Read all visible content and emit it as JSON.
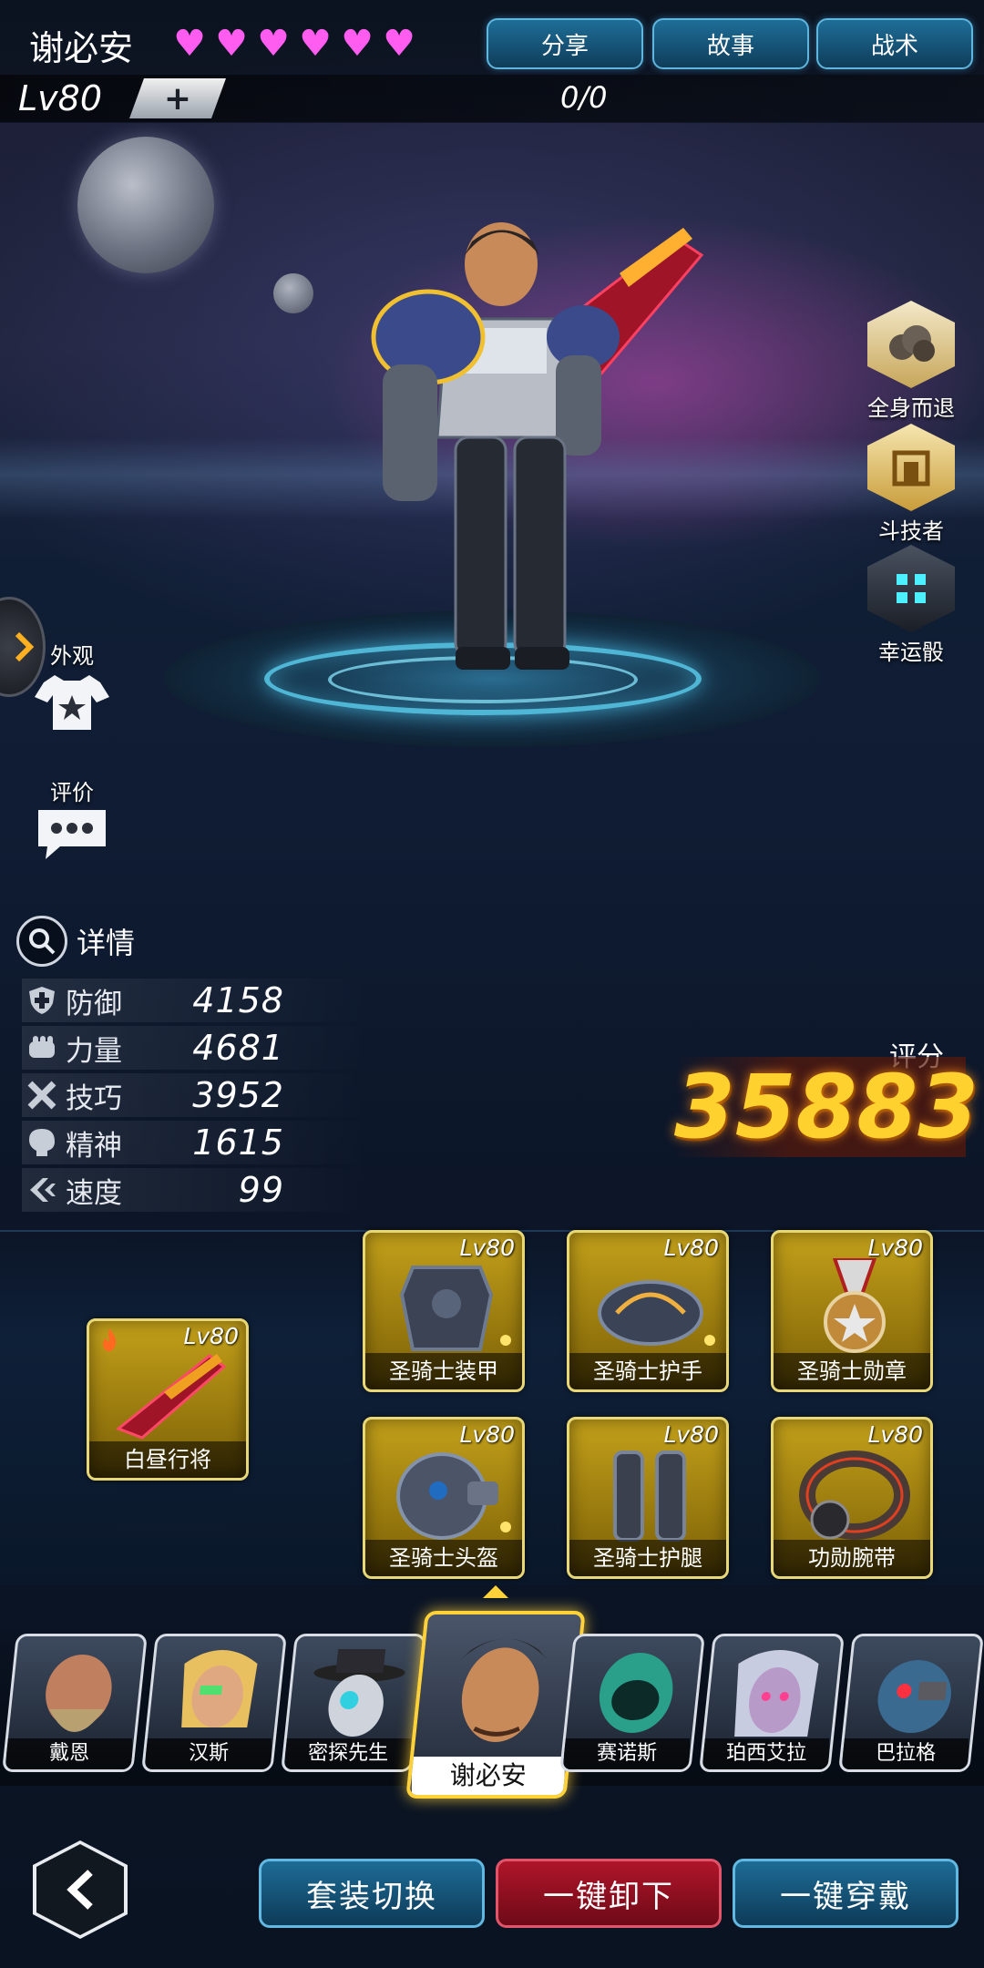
{
  "header": {
    "character_name": "谢必安",
    "hearts": [
      "♥",
      "♥",
      "♥",
      "♥",
      "♥",
      "♥"
    ],
    "heart_color": "#ff5cf0",
    "buttons": {
      "share": "分享",
      "story": "故事",
      "tactics": "战术"
    },
    "level": "Lv80",
    "level_plus": "+",
    "exp": "0/0"
  },
  "skills": [
    {
      "label": "全身而退",
      "icon": "explosion-icon"
    },
    {
      "label": "斗技者",
      "icon": "armor-emblem-icon"
    },
    {
      "label": "幸运骰",
      "icon": "dice-icon"
    }
  ],
  "side": {
    "appearance": "外观",
    "review": "评价"
  },
  "details": {
    "title": "详情",
    "stats": [
      {
        "name": "防御",
        "value": "4158",
        "icon": "shield-icon"
      },
      {
        "name": "力量",
        "value": "4681",
        "icon": "fist-icon"
      },
      {
        "name": "技巧",
        "value": "3952",
        "icon": "tools-icon"
      },
      {
        "name": "精神",
        "value": "1615",
        "icon": "brain-icon"
      },
      {
        "name": "速度",
        "value": "99",
        "icon": "speed-icon"
      }
    ]
  },
  "score": {
    "label": "评分",
    "value": "35883",
    "color": "#ffd12e"
  },
  "equipment": {
    "weapon": {
      "name": "白昼行将",
      "level": "Lv80"
    },
    "slots": [
      {
        "name": "圣骑士装甲",
        "level": "Lv80"
      },
      {
        "name": "圣骑士护手",
        "level": "Lv80"
      },
      {
        "name": "圣骑士勋章",
        "level": "Lv80"
      },
      {
        "name": "圣骑士头盔",
        "level": "Lv80"
      },
      {
        "name": "圣骑士护腿",
        "level": "Lv80"
      },
      {
        "name": "功勋腕带",
        "level": "Lv80"
      }
    ]
  },
  "heroes": [
    {
      "name": "戴恩"
    },
    {
      "name": "汉斯"
    },
    {
      "name": "密探先生"
    },
    {
      "name": "谢必安",
      "selected": true
    },
    {
      "name": "赛诺斯"
    },
    {
      "name": "珀西艾拉"
    },
    {
      "name": "巴拉格"
    }
  ],
  "bottom": {
    "switch_set": "套装切换",
    "unequip_all": "一键卸下",
    "equip_all": "一键穿戴"
  }
}
